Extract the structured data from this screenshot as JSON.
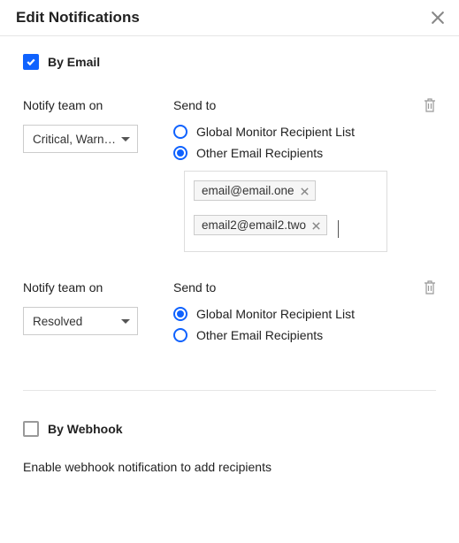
{
  "header": {
    "title": "Edit Notifications"
  },
  "email": {
    "checkbox_label": "By Email",
    "checked": true,
    "notify_label": "Notify team on",
    "send_to_label": "Send to",
    "option_global": "Global Monitor Recipient List",
    "option_other": "Other Email Recipients"
  },
  "section1": {
    "select_value": "Critical, Warn…",
    "selected_radio": "other",
    "tags": [
      "email@email.one",
      "email2@email2.two"
    ]
  },
  "section2": {
    "select_value": "Resolved",
    "selected_radio": "global"
  },
  "webhook": {
    "checkbox_label": "By Webhook",
    "checked": false,
    "hint": "Enable webhook notification to add recipients"
  }
}
